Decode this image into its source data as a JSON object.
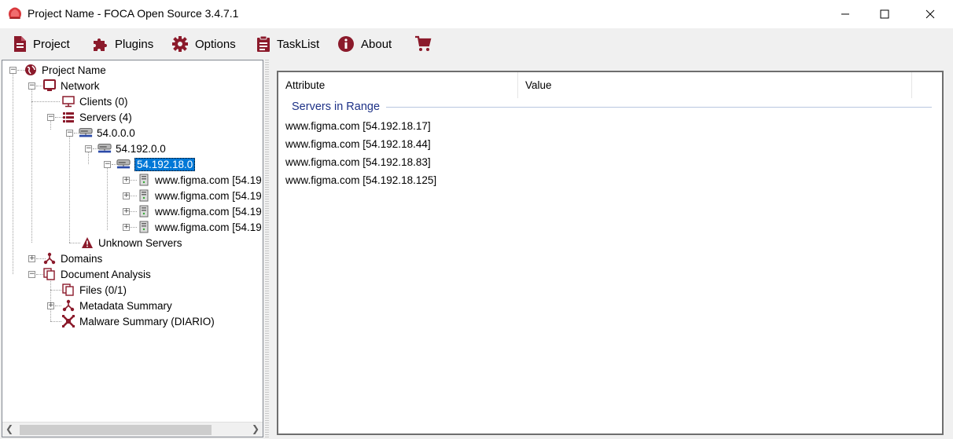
{
  "window": {
    "title": "Project Name - FOCA Open Source 3.4.7.1",
    "controls": [
      "minimize",
      "maximize",
      "close"
    ]
  },
  "menu": {
    "items": [
      {
        "label": "Project",
        "icon": "document-icon"
      },
      {
        "label": "Plugins",
        "icon": "puzzle-icon"
      },
      {
        "label": "Options",
        "icon": "gear-icon"
      },
      {
        "label": "TaskList",
        "icon": "clipboard-icon"
      },
      {
        "label": "About",
        "icon": "info-icon"
      },
      {
        "label": "",
        "icon": "cart-icon"
      }
    ]
  },
  "tree": {
    "project": "Project Name",
    "network": "Network",
    "clients": "Clients (0)",
    "servers": "Servers (4)",
    "range_a": "54.0.0.0",
    "range_b": "54.192.0.0",
    "range_c": "54.192.18.0",
    "hosts": [
      "www.figma.com [54.19",
      "www.figma.com [54.19",
      "www.figma.com [54.19",
      "www.figma.com [54.19"
    ],
    "unknown_servers": "Unknown Servers",
    "domains": "Domains",
    "document_analysis": "Document Analysis",
    "files": "Files (0/1)",
    "metadata_summary": "Metadata Summary",
    "malware_summary": "Malware Summary (DIARIO)"
  },
  "list": {
    "columns": [
      "Attribute",
      "Value"
    ],
    "group": "Servers in Range",
    "rows": [
      "www.figma.com [54.192.18.17]",
      "www.figma.com [54.192.18.44]",
      "www.figma.com [54.192.18.83]",
      "www.figma.com [54.192.18.125]"
    ]
  },
  "colors": {
    "accent": "#8b1a2b",
    "selection": "#0078d7",
    "group_header": "#1e3287"
  }
}
